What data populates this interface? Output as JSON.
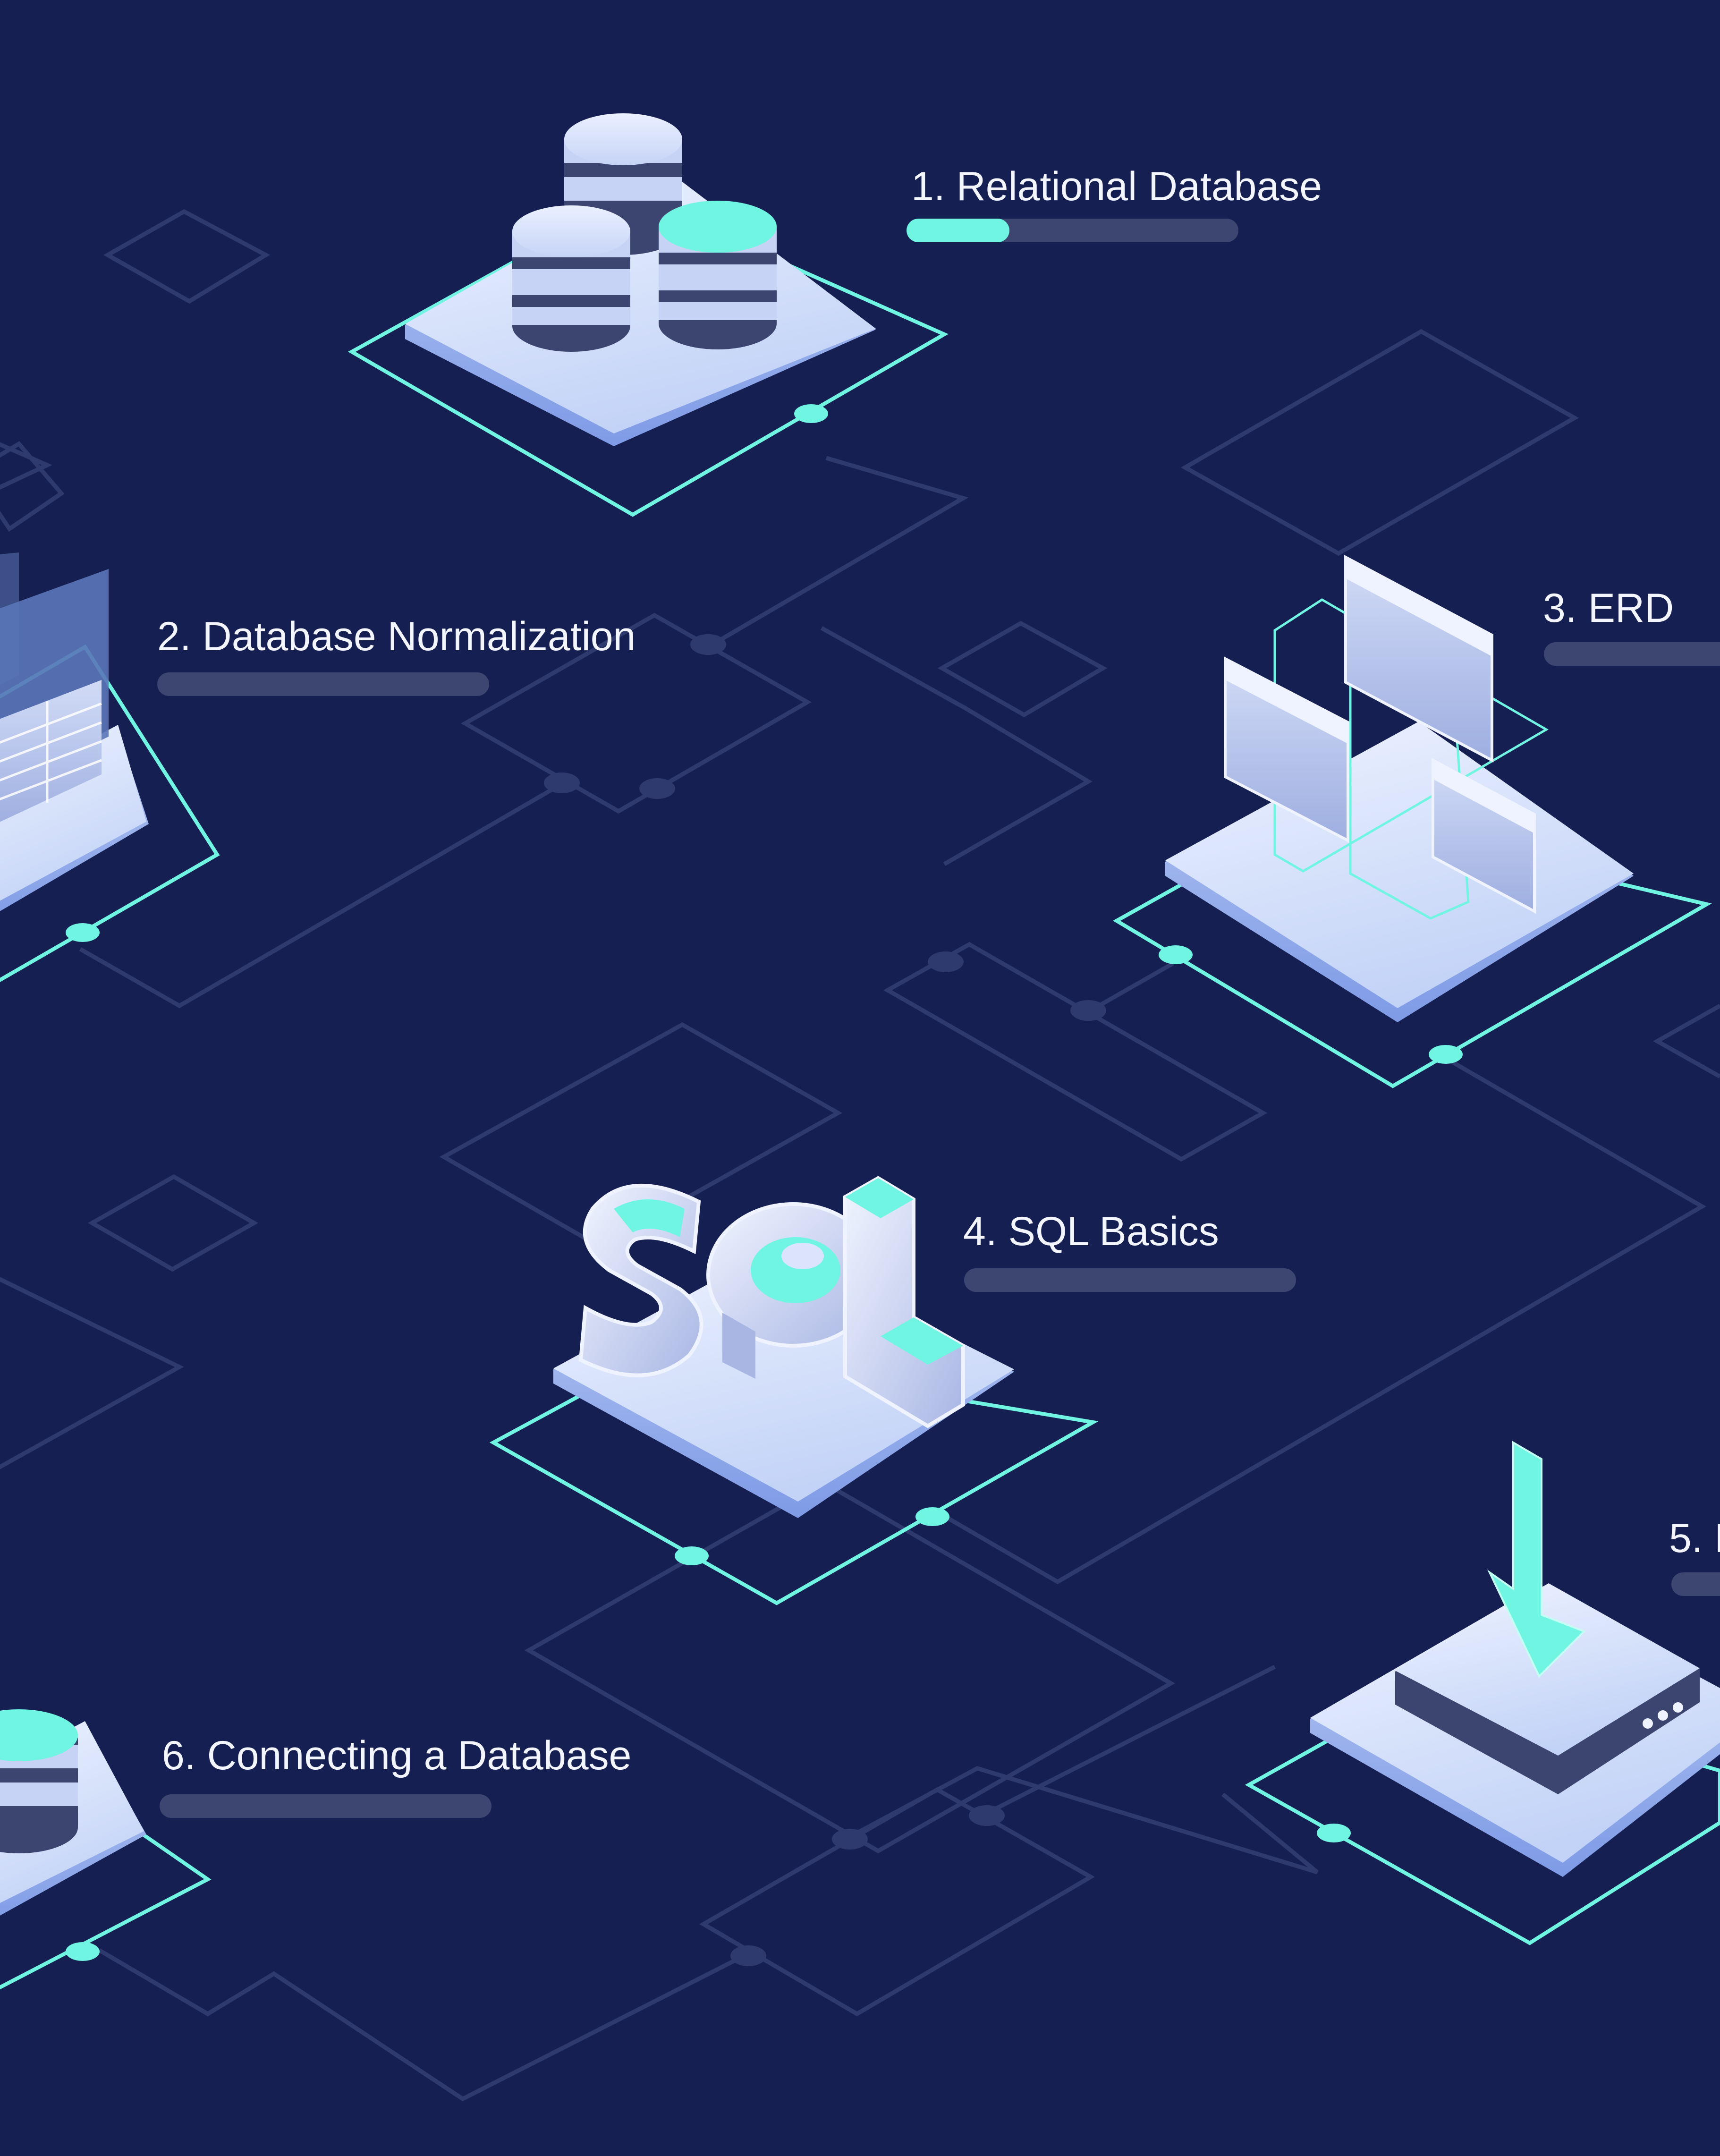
{
  "theme": {
    "background": "#161f52",
    "accent": "#6ff5e1",
    "grid_line": "#2e3a6e",
    "track": "#3d4670",
    "label_color": "#f4f6ff"
  },
  "modules": [
    {
      "label": "1. Relational Database",
      "progress": 0.31,
      "icon": "database-cluster-icon"
    },
    {
      "label": "2. Database Normalization",
      "progress": 0,
      "icon": "table-screen-icon"
    },
    {
      "label": "3. ERD",
      "progress": 0,
      "icon": "entity-relationship-icon"
    },
    {
      "label": "4. SQL Basics",
      "progress": 0,
      "icon": "sql-letters-icon"
    },
    {
      "label": "5. I",
      "progress": 0,
      "icon": "download-server-icon"
    },
    {
      "label": "6. Connecting a Database",
      "progress": 0,
      "icon": "database-icon"
    }
  ]
}
